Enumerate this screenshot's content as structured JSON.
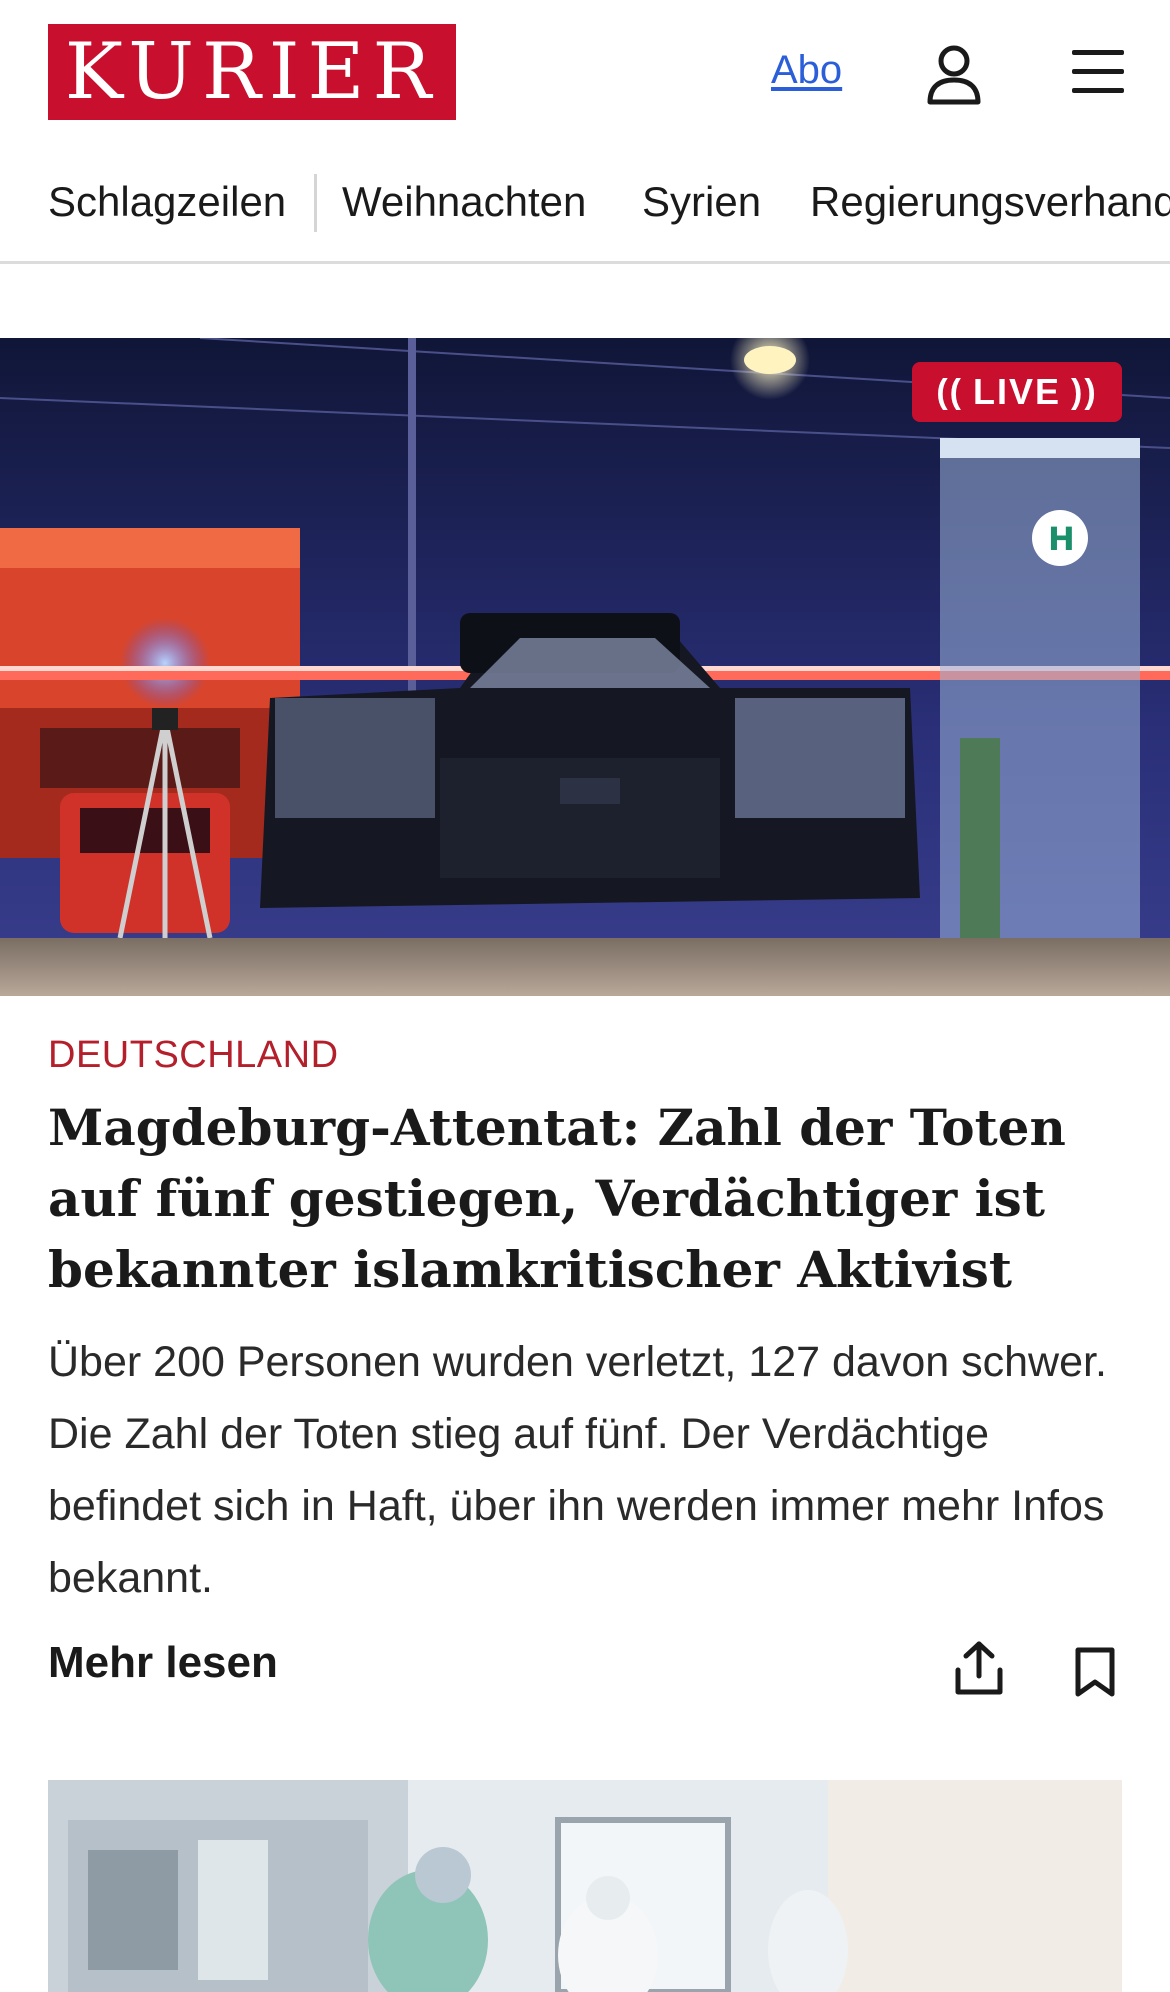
{
  "header": {
    "logo_text": "KURIER",
    "abo_label": "Abo",
    "user_icon": "user-icon",
    "menu_icon": "hamburger-menu-icon",
    "brand_color": "#c8102e",
    "link_color": "#2b5fd9"
  },
  "nav": {
    "items": [
      {
        "label": "Schlagzeilen"
      },
      {
        "label": "Weihnachten"
      },
      {
        "label": "Syrien"
      },
      {
        "label": "Regierungsverhandlungen"
      }
    ]
  },
  "hero": {
    "live_label": "LIVE",
    "image_alt": "Damaged car behind police tape at night with fire engines"
  },
  "article": {
    "kicker": "DEUTSCHLAND",
    "headline": "Magdeburg-Attentat: Zahl der Toten auf fünf gestiegen, Verdächtiger ist bekannter islamkritischer Aktivist",
    "teaser": "Über 200 Personen wurden verletzt, 127 davon schwer. Die Zahl der Toten stieg auf fünf. Der Verdächtige befindet sich in Haft, über ihn werden immer mehr Infos bekannt.",
    "more_label": "Mehr lesen",
    "share_icon": "share-icon",
    "bookmark_icon": "bookmark-icon",
    "kicker_color": "#b41f2c"
  }
}
